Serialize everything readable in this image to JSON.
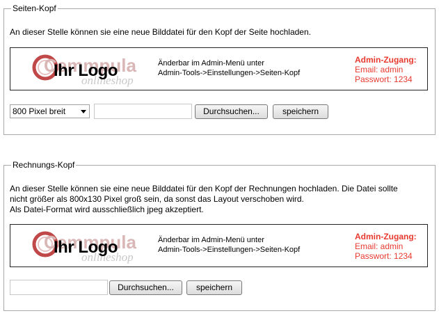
{
  "sections": [
    {
      "legend": "Seiten-Kopf",
      "description": [
        "An dieser Stelle können sie eine neue Bilddatei für den Kopf der Seite hochladen."
      ],
      "banner": {
        "logo_text": "Ihr Logo",
        "logo_brand": "Cemmpula",
        "logo_sub": "onlineshop",
        "note_lines": [
          "Änderbar im Admin-Menü unter",
          "Admin-Tools->Einstellungen->Seiten-Kopf"
        ],
        "admin_title": "Admin-Zugang:",
        "admin_email": "Email: admin",
        "admin_password": "Passwort: 1234"
      },
      "select_value": "800 Pixel breit",
      "browse_label": "Durchsuchen...",
      "save_label": "speichern"
    },
    {
      "legend": "Rechnungs-Kopf",
      "description": [
        "An dieser Stelle können sie eine neue Bilddatei für den Kopf der Rechnungen hochladen. Die Datei sollte",
        "nicht größer als 800x130 Pixel groß sein, da sonst das Layout verschoben wird.",
        "Als Datei-Format wird ausschließlich jpeg akzeptiert."
      ],
      "banner": {
        "logo_text": "Ihr Logo",
        "logo_brand": "Cemmpula",
        "logo_sub": "onlineshop",
        "note_lines": [
          "Änderbar im Admin-Menü unter",
          "Admin-Tools->Einstellungen->Seiten-Kopf"
        ],
        "admin_title": "Admin-Zugang:",
        "admin_email": "Email: admin",
        "admin_password": "Passwort: 1234"
      },
      "browse_label": "Durchsuchen...",
      "save_label": "speichern"
    }
  ],
  "colors": {
    "admin_red": "#e8392f",
    "logo_ring": "#c04848",
    "logo_watermark": "#d9b7b7"
  }
}
